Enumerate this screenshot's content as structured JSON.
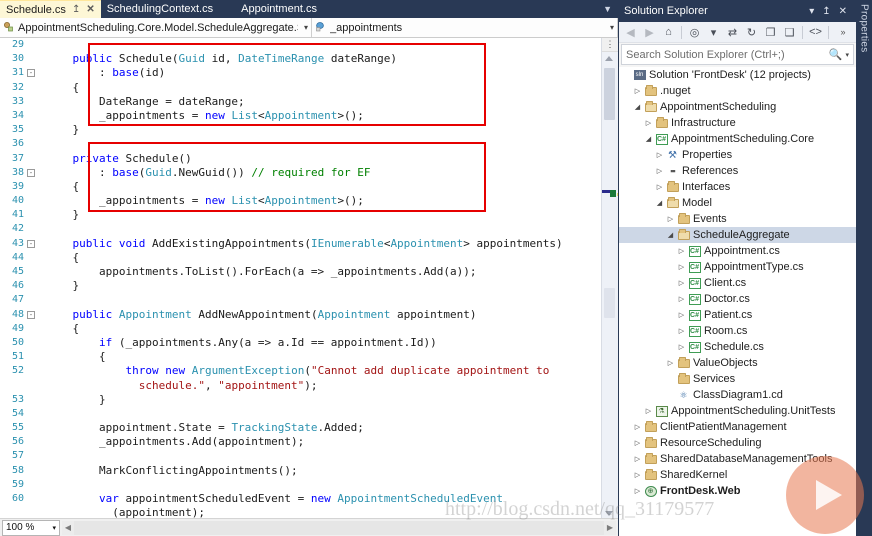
{
  "tabs": [
    {
      "label": "Schedule.cs",
      "active": true,
      "pin": "↥",
      "close": "✕"
    },
    {
      "label": "SchedulingContext.cs",
      "active": false
    },
    {
      "label": "Appointment.cs",
      "active": false
    }
  ],
  "tabstrip": {
    "overflow_chevron": "▼"
  },
  "navbar": {
    "type_scope": "AppointmentScheduling.Core.Model.ScheduleAggregate.S",
    "member_scope": "_appointments",
    "type_icon": "class-icon",
    "member_icon": "field-icon",
    "dropdown_arrow": "▾"
  },
  "editor": {
    "first_line": 29,
    "zoom": "100 %",
    "zoom_arrow": "▾",
    "split_icon": "split-view-icon",
    "warning_icon": "warning-triangle-icon",
    "scroll_up_arrow": "▲",
    "scroll_down_arrow": "▼",
    "hscroll_left": "◀",
    "hscroll_right": "▶",
    "lines": [
      {
        "n": 29,
        "fold": "",
        "guide": false,
        "tokens": []
      },
      {
        "n": 30,
        "fold": "",
        "guide": false,
        "tokens": [
          {
            "t": "    ",
            "c": "nrm"
          },
          {
            "t": "public",
            "c": "kw"
          },
          {
            "t": " Schedule(",
            "c": "nrm"
          },
          {
            "t": "Guid",
            "c": "typ"
          },
          {
            "t": " id, ",
            "c": "nrm"
          },
          {
            "t": "DateTimeRange",
            "c": "typ"
          },
          {
            "t": " dateRange)",
            "c": "nrm"
          }
        ]
      },
      {
        "n": 31,
        "fold": "-",
        "guide": false,
        "tokens": [
          {
            "t": "        : ",
            "c": "nrm"
          },
          {
            "t": "base",
            "c": "kw"
          },
          {
            "t": "(id)",
            "c": "nrm"
          }
        ]
      },
      {
        "n": 32,
        "fold": "",
        "guide": false,
        "tokens": [
          {
            "t": "    {",
            "c": "nrm"
          }
        ]
      },
      {
        "n": 33,
        "fold": "",
        "guide": true,
        "tokens": [
          {
            "t": "        DateRange = dateRange;",
            "c": "nrm"
          }
        ]
      },
      {
        "n": 34,
        "fold": "",
        "guide": true,
        "tokens": [
          {
            "t": "        _appointments = ",
            "c": "nrm"
          },
          {
            "t": "new",
            "c": "kw"
          },
          {
            "t": " ",
            "c": "nrm"
          },
          {
            "t": "List",
            "c": "typ"
          },
          {
            "t": "<",
            "c": "nrm"
          },
          {
            "t": "Appointment",
            "c": "typ"
          },
          {
            "t": ">();",
            "c": "nrm"
          }
        ]
      },
      {
        "n": 35,
        "fold": "",
        "guide": false,
        "tokens": [
          {
            "t": "    }",
            "c": "nrm"
          }
        ]
      },
      {
        "n": 36,
        "fold": "",
        "guide": false,
        "tokens": []
      },
      {
        "n": 37,
        "fold": "",
        "guide": false,
        "tokens": [
          {
            "t": "    ",
            "c": "nrm"
          },
          {
            "t": "private",
            "c": "kw"
          },
          {
            "t": " Schedule()",
            "c": "nrm"
          }
        ]
      },
      {
        "n": 38,
        "fold": "-",
        "guide": false,
        "tokens": [
          {
            "t": "        : ",
            "c": "nrm"
          },
          {
            "t": "base",
            "c": "kw"
          },
          {
            "t": "(",
            "c": "nrm"
          },
          {
            "t": "Guid",
            "c": "typ"
          },
          {
            "t": ".NewGuid()) ",
            "c": "nrm"
          },
          {
            "t": "// required for EF",
            "c": "cmt"
          }
        ]
      },
      {
        "n": 39,
        "fold": "",
        "guide": false,
        "tokens": [
          {
            "t": "    {",
            "c": "nrm"
          }
        ]
      },
      {
        "n": 40,
        "fold": "",
        "guide": true,
        "tokens": [
          {
            "t": "        _appointments = ",
            "c": "nrm"
          },
          {
            "t": "new",
            "c": "kw"
          },
          {
            "t": " ",
            "c": "nrm"
          },
          {
            "t": "List",
            "c": "typ"
          },
          {
            "t": "<",
            "c": "nrm"
          },
          {
            "t": "Appointment",
            "c": "typ"
          },
          {
            "t": ">();",
            "c": "nrm"
          }
        ]
      },
      {
        "n": 41,
        "fold": "",
        "guide": false,
        "tokens": [
          {
            "t": "    }",
            "c": "nrm"
          }
        ]
      },
      {
        "n": 42,
        "fold": "",
        "guide": false,
        "tokens": []
      },
      {
        "n": 43,
        "fold": "-",
        "guide": false,
        "tokens": [
          {
            "t": "    ",
            "c": "nrm"
          },
          {
            "t": "public",
            "c": "kw"
          },
          {
            "t": " ",
            "c": "nrm"
          },
          {
            "t": "void",
            "c": "kw"
          },
          {
            "t": " AddExistingAppointments(",
            "c": "nrm"
          },
          {
            "t": "IEnumerable",
            "c": "typ"
          },
          {
            "t": "<",
            "c": "nrm"
          },
          {
            "t": "Appointment",
            "c": "typ"
          },
          {
            "t": "> appointments)",
            "c": "nrm"
          }
        ]
      },
      {
        "n": 44,
        "fold": "",
        "guide": false,
        "tokens": [
          {
            "t": "    {",
            "c": "nrm"
          }
        ]
      },
      {
        "n": 45,
        "fold": "",
        "guide": true,
        "tokens": [
          {
            "t": "        appointments.ToList().ForEach(a => _appointments.Add(a));",
            "c": "nrm"
          }
        ]
      },
      {
        "n": 46,
        "fold": "",
        "guide": false,
        "tokens": [
          {
            "t": "    }",
            "c": "nrm"
          }
        ]
      },
      {
        "n": 47,
        "fold": "",
        "guide": false,
        "tokens": []
      },
      {
        "n": 48,
        "fold": "-",
        "guide": false,
        "tokens": [
          {
            "t": "    ",
            "c": "nrm"
          },
          {
            "t": "public",
            "c": "kw"
          },
          {
            "t": " ",
            "c": "nrm"
          },
          {
            "t": "Appointment",
            "c": "typ"
          },
          {
            "t": " AddNewAppointment(",
            "c": "nrm"
          },
          {
            "t": "Appointment",
            "c": "typ"
          },
          {
            "t": " appointment)",
            "c": "nrm"
          }
        ]
      },
      {
        "n": 49,
        "fold": "",
        "guide": false,
        "tokens": [
          {
            "t": "    {",
            "c": "nrm"
          }
        ]
      },
      {
        "n": 50,
        "fold": "",
        "guide": true,
        "tokens": [
          {
            "t": "        ",
            "c": "nrm"
          },
          {
            "t": "if",
            "c": "kw"
          },
          {
            "t": " (_appointments.Any(a => a.Id == appointment.Id))",
            "c": "nrm"
          }
        ]
      },
      {
        "n": 51,
        "fold": "",
        "guide": true,
        "tokens": [
          {
            "t": "        {",
            "c": "nrm"
          }
        ]
      },
      {
        "n": 52,
        "fold": "",
        "guide": true,
        "tokens": [
          {
            "t": "            ",
            "c": "nrm"
          },
          {
            "t": "throw",
            "c": "kw"
          },
          {
            "t": " ",
            "c": "nrm"
          },
          {
            "t": "new",
            "c": "kw"
          },
          {
            "t": " ",
            "c": "nrm"
          },
          {
            "t": "ArgumentException",
            "c": "typ"
          },
          {
            "t": "(",
            "c": "nrm"
          },
          {
            "t": "\"Cannot add duplicate appointment to",
            "c": "str"
          }
        ]
      },
      {
        "n": "",
        "fold": "",
        "guide": true,
        "wrap": true,
        "tokens": [
          {
            "t": "              ",
            "c": "nrm"
          },
          {
            "t": "schedule.\"",
            "c": "str"
          },
          {
            "t": ", ",
            "c": "nrm"
          },
          {
            "t": "\"appointment\"",
            "c": "str"
          },
          {
            "t": ");",
            "c": "nrm"
          }
        ]
      },
      {
        "n": 53,
        "fold": "",
        "guide": true,
        "tokens": [
          {
            "t": "        }",
            "c": "nrm"
          }
        ]
      },
      {
        "n": 54,
        "fold": "",
        "guide": true,
        "tokens": []
      },
      {
        "n": 55,
        "fold": "",
        "guide": true,
        "tokens": [
          {
            "t": "        appointment.State = ",
            "c": "nrm"
          },
          {
            "t": "TrackingState",
            "c": "typ"
          },
          {
            "t": ".Added;",
            "c": "nrm"
          }
        ]
      },
      {
        "n": 56,
        "fold": "",
        "guide": true,
        "tokens": [
          {
            "t": "        _appointments.Add(appointment);",
            "c": "nrm"
          }
        ]
      },
      {
        "n": 57,
        "fold": "",
        "guide": true,
        "tokens": []
      },
      {
        "n": 58,
        "fold": "",
        "guide": true,
        "tokens": [
          {
            "t": "        MarkConflictingAppointments();",
            "c": "nrm"
          }
        ]
      },
      {
        "n": 59,
        "fold": "",
        "guide": true,
        "tokens": []
      },
      {
        "n": 60,
        "fold": "",
        "guide": true,
        "tokens": [
          {
            "t": "        ",
            "c": "nrm"
          },
          {
            "t": "var",
            "c": "kw"
          },
          {
            "t": " appointmentScheduledEvent = ",
            "c": "nrm"
          },
          {
            "t": "new",
            "c": "kw"
          },
          {
            "t": " ",
            "c": "nrm"
          },
          {
            "t": "AppointmentScheduledEvent",
            "c": "typ"
          }
        ]
      },
      {
        "n": "",
        "fold": "",
        "guide": true,
        "wrap": true,
        "tokens": [
          {
            "t": "          (appointment);",
            "c": "nrm"
          }
        ]
      }
    ]
  },
  "solution_explorer": {
    "title": "Solution Explorer",
    "dropdown_icon": "▾",
    "pin_icon": "↥",
    "close_icon": "✕",
    "toolbar": [
      {
        "name": "back-icon",
        "glyph": "◀",
        "dim": true
      },
      {
        "name": "forward-icon",
        "glyph": "▶",
        "dim": true
      },
      {
        "name": "home-icon",
        "glyph": "⌂",
        "dim": false
      },
      {
        "name": "sync-with-document-icon",
        "glyph": "◎",
        "dim": false
      },
      {
        "name": "sync-dropdown-icon",
        "glyph": "▾",
        "dim": false
      },
      {
        "name": "sync-active-document-icon",
        "glyph": "⇄",
        "dim": false
      },
      {
        "name": "refresh-icon",
        "glyph": "↻",
        "dim": false
      },
      {
        "name": "collapse-all-icon",
        "glyph": "❐",
        "dim": false
      },
      {
        "name": "properties-window-icon",
        "glyph": "❑",
        "dim": false
      },
      {
        "name": "show-all-files-icon",
        "glyph": "<>",
        "dim": false
      },
      {
        "name": "toolbar-overflow-icon",
        "glyph": "»",
        "dim": false
      }
    ],
    "search_placeholder": "Search Solution Explorer (Ctrl+;)",
    "search_icon": "search-magnifier-icon",
    "search_dropdown": "▾",
    "tree": [
      {
        "label": "Solution 'FrontDesk' (12 projects)",
        "depth": 0,
        "exp": "",
        "icon": "solution",
        "selected": false,
        "bold": false
      },
      {
        "label": ".nuget",
        "depth": 1,
        "exp": "▷",
        "icon": "folder",
        "selected": false,
        "bold": false
      },
      {
        "label": "AppointmentScheduling",
        "depth": 1,
        "exp": "◢",
        "icon": "folder-open",
        "selected": false,
        "bold": false
      },
      {
        "label": "Infrastructure",
        "depth": 2,
        "exp": "▷",
        "icon": "folder",
        "selected": false,
        "bold": false
      },
      {
        "label": "AppointmentScheduling.Core",
        "depth": 2,
        "exp": "◢",
        "icon": "cs",
        "selected": false,
        "bold": false
      },
      {
        "label": "Properties",
        "depth": 3,
        "exp": "▷",
        "icon": "wrench",
        "selected": false,
        "bold": false
      },
      {
        "label": "References",
        "depth": 3,
        "exp": "▷",
        "icon": "refs",
        "selected": false,
        "bold": false
      },
      {
        "label": "Interfaces",
        "depth": 3,
        "exp": "▷",
        "icon": "folder",
        "selected": false,
        "bold": false
      },
      {
        "label": "Model",
        "depth": 3,
        "exp": "◢",
        "icon": "folder-open",
        "selected": false,
        "bold": false
      },
      {
        "label": "Events",
        "depth": 4,
        "exp": "▷",
        "icon": "folder",
        "selected": false,
        "bold": false
      },
      {
        "label": "ScheduleAggregate",
        "depth": 4,
        "exp": "◢",
        "icon": "folder-open",
        "selected": true,
        "bold": false
      },
      {
        "label": "Appointment.cs",
        "depth": 5,
        "exp": "▷",
        "icon": "cs",
        "selected": false,
        "bold": false
      },
      {
        "label": "AppointmentType.cs",
        "depth": 5,
        "exp": "▷",
        "icon": "cs",
        "selected": false,
        "bold": false
      },
      {
        "label": "Client.cs",
        "depth": 5,
        "exp": "▷",
        "icon": "cs",
        "selected": false,
        "bold": false
      },
      {
        "label": "Doctor.cs",
        "depth": 5,
        "exp": "▷",
        "icon": "cs",
        "selected": false,
        "bold": false
      },
      {
        "label": "Patient.cs",
        "depth": 5,
        "exp": "▷",
        "icon": "cs",
        "selected": false,
        "bold": false
      },
      {
        "label": "Room.cs",
        "depth": 5,
        "exp": "▷",
        "icon": "cs",
        "selected": false,
        "bold": false
      },
      {
        "label": "Schedule.cs",
        "depth": 5,
        "exp": "▷",
        "icon": "cs",
        "selected": false,
        "bold": false
      },
      {
        "label": "ValueObjects",
        "depth": 4,
        "exp": "▷",
        "icon": "folder",
        "selected": false,
        "bold": false
      },
      {
        "label": "Services",
        "depth": 4,
        "exp": "",
        "icon": "folder",
        "selected": false,
        "bold": false
      },
      {
        "label": "ClassDiagram1.cd",
        "depth": 4,
        "exp": "",
        "icon": "cd",
        "selected": false,
        "bold": false
      },
      {
        "label": "AppointmentScheduling.UnitTests",
        "depth": 2,
        "exp": "▷",
        "icon": "test",
        "selected": false,
        "bold": false
      },
      {
        "label": "ClientPatientManagement",
        "depth": 1,
        "exp": "▷",
        "icon": "folder",
        "selected": false,
        "bold": false
      },
      {
        "label": "ResourceScheduling",
        "depth": 1,
        "exp": "▷",
        "icon": "folder",
        "selected": false,
        "bold": false
      },
      {
        "label": "SharedDatabaseManagementTools",
        "depth": 1,
        "exp": "▷",
        "icon": "folder",
        "selected": false,
        "bold": false
      },
      {
        "label": "SharedKernel",
        "depth": 1,
        "exp": "▷",
        "icon": "folder",
        "selected": false,
        "bold": false
      },
      {
        "label": "FrontDesk.Web",
        "depth": 1,
        "exp": "▷",
        "icon": "web",
        "selected": false,
        "bold": true
      }
    ]
  },
  "properties_panel": {
    "label": "Properties"
  },
  "watermark": {
    "text": "http://blog.csdn.net/qq_31179577"
  },
  "colors": {
    "chrome": "#293955",
    "active_tab": "#fdf7d6",
    "keyword": "#0000ff",
    "type": "#2b91af",
    "string": "#a31515",
    "comment": "#008000",
    "highlight_box": "#e60000",
    "tree_selection": "#cdd7e6"
  }
}
